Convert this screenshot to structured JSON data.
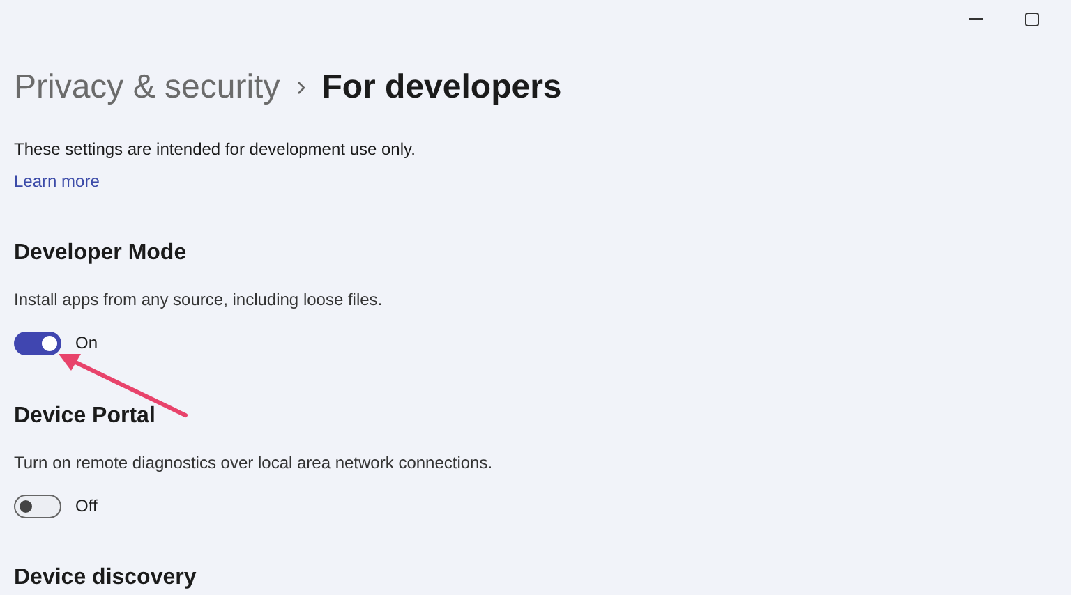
{
  "breadcrumb": {
    "parent": "Privacy & security",
    "current": "For developers"
  },
  "description": "These settings are intended for development use only.",
  "link": "Learn more",
  "sections": [
    {
      "title": "Developer Mode",
      "description": "Install apps from any source, including loose files.",
      "toggle": {
        "on": true,
        "label": "On"
      }
    },
    {
      "title": "Device Portal",
      "description": "Turn on remote diagnostics over local area network connections.",
      "toggle": {
        "on": false,
        "label": "Off"
      }
    },
    {
      "title": "Device discovery"
    }
  ],
  "annotation": {
    "kind": "arrow"
  }
}
